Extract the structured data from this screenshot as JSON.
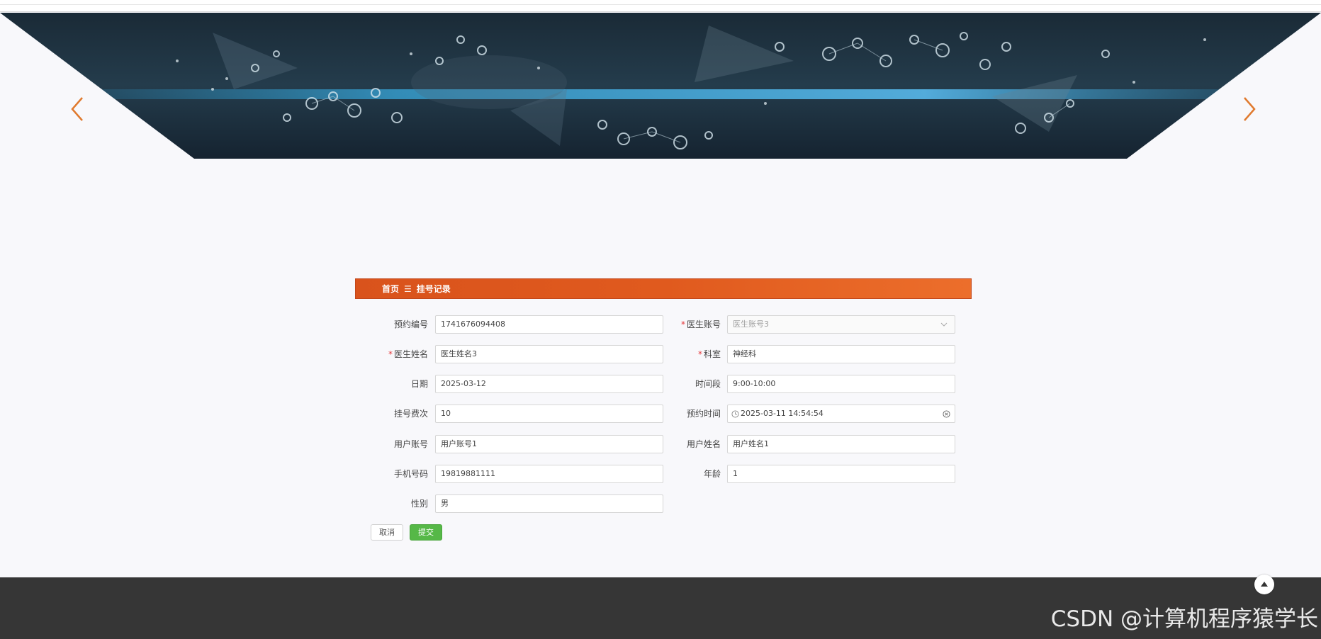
{
  "breadcrumb": {
    "home": "首页",
    "separator": "☰",
    "current": "挂号记录"
  },
  "banner": {
    "prev_icon": "chevron-left-icon",
    "next_icon": "chevron-right-icon",
    "arrow_color": "#e07a2e"
  },
  "form": {
    "appointment_no": {
      "label": "预约编号",
      "value": "1741676094408"
    },
    "doctor_account": {
      "label": "医生账号",
      "value": "医生账号3",
      "required": true
    },
    "doctor_name": {
      "label": "医生姓名",
      "value": "医生姓名3",
      "required": true
    },
    "department": {
      "label": "科室",
      "value": "神经科",
      "required": true
    },
    "date": {
      "label": "日期",
      "value": "2025-03-12"
    },
    "time_slot": {
      "label": "时间段",
      "value": "9:00-10:00"
    },
    "fee": {
      "label": "挂号费次",
      "value": "10"
    },
    "appointment_time": {
      "label": "预约时间",
      "value": "2025-03-11 14:54:54"
    },
    "user_account": {
      "label": "用户账号",
      "value": "用户账号1"
    },
    "user_name": {
      "label": "用户姓名",
      "value": "用户姓名1"
    },
    "phone": {
      "label": "手机号码",
      "value": "19819881111"
    },
    "age": {
      "label": "年龄",
      "value": "1"
    },
    "gender": {
      "label": "性别",
      "value": "男"
    },
    "required_mark": "*"
  },
  "buttons": {
    "cancel": "取消",
    "submit": "提交"
  },
  "colors": {
    "header_orange": "#e05a1e",
    "submit_green": "#56b847",
    "footer": "#363636"
  },
  "watermark": "CSDN @计算机程序猿学长"
}
